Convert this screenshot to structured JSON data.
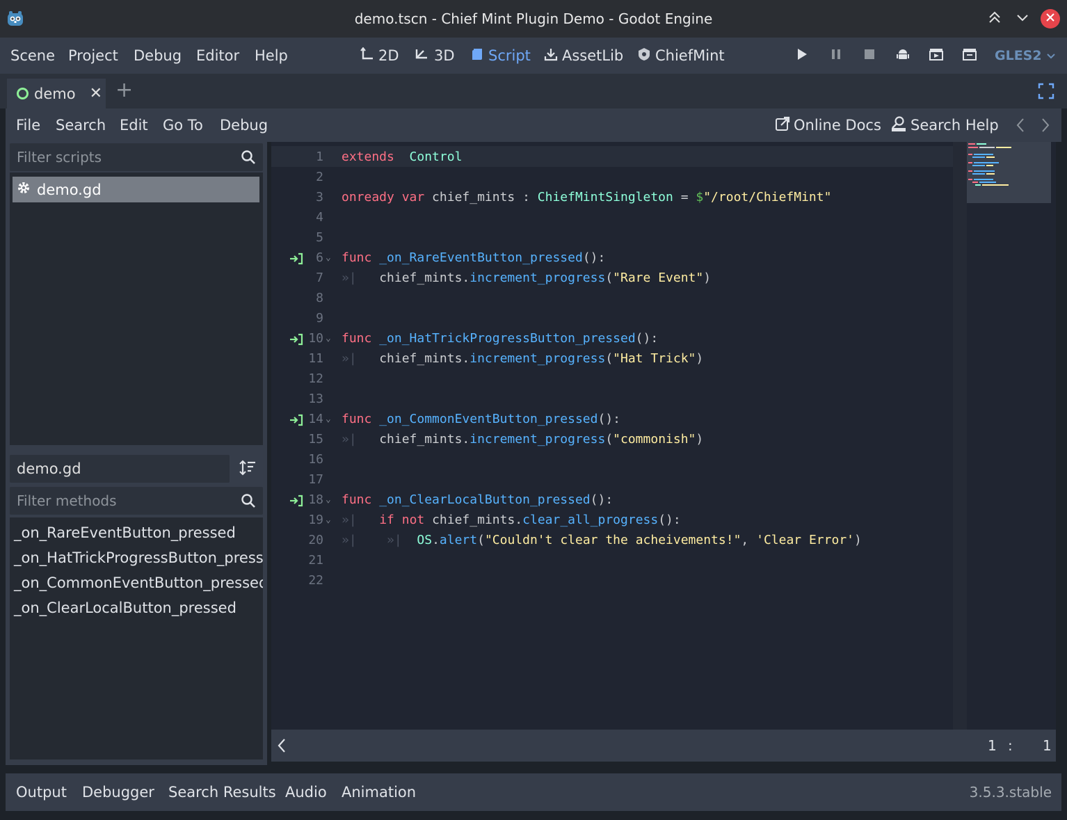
{
  "window": {
    "title": "demo.tscn - Chief Mint Plugin Demo - Godot Engine",
    "icons": [
      "godot-logo",
      "collapse-up",
      "chevron-down",
      "close"
    ],
    "close_color": "#e5444b"
  },
  "main_menu": {
    "items": [
      "Scene",
      "Project",
      "Debug",
      "Editor",
      "Help"
    ],
    "workspaces": [
      {
        "label": "2D",
        "icon": "2d-icon",
        "active": false
      },
      {
        "label": "3D",
        "icon": "3d-icon",
        "active": false
      },
      {
        "label": "Script",
        "icon": "script-icon",
        "active": true
      },
      {
        "label": "AssetLib",
        "icon": "download-icon",
        "active": false
      },
      {
        "label": "ChiefMint",
        "icon": "chiefmint-icon",
        "active": false
      }
    ],
    "tools": [
      "play-icon",
      "pause-icon",
      "stop-icon",
      "android-icon",
      "play-scene-icon",
      "play-custom-scene-icon"
    ],
    "renderer": "GLES2",
    "accent_color": "#6fa8f8"
  },
  "scene_tabs": {
    "active": "demo",
    "close_glyph": "✕",
    "add_glyph": "+"
  },
  "script_menu": {
    "items": [
      "File",
      "Search",
      "Edit",
      "Go To",
      "Debug"
    ],
    "online_docs": "Online Docs",
    "search_help": "Search Help"
  },
  "scripts_panel": {
    "filter_placeholder": "Filter scripts",
    "scripts": [
      "demo.gd"
    ],
    "current_script": "demo.gd",
    "methods_filter_placeholder": "Filter methods",
    "methods": [
      "_on_RareEventButton_pressed",
      "_on_HatTrickProgressButton_presse",
      "_on_CommonEventButton_pressed",
      "_on_ClearLocalButton_pressed"
    ]
  },
  "code": {
    "lines": [
      {
        "n": "1",
        "fold": false,
        "signal": false,
        "tokens": [
          [
            "kw",
            "extends"
          ],
          [
            "",
            "  "
          ],
          [
            "ty",
            "Control"
          ]
        ]
      },
      {
        "n": "2",
        "fold": false,
        "signal": false,
        "tokens": []
      },
      {
        "n": "3",
        "fold": false,
        "signal": false,
        "tokens": [
          [
            "kw",
            "onready"
          ],
          [
            "",
            " "
          ],
          [
            "kw",
            "var"
          ],
          [
            "",
            " chief_mints : "
          ],
          [
            "ty",
            "ChiefMintSingleton"
          ],
          [
            "",
            " = "
          ],
          [
            "np",
            "$"
          ],
          [
            "st",
            "\"/root/ChiefMint\""
          ]
        ]
      },
      {
        "n": "4",
        "fold": false,
        "signal": false,
        "tokens": []
      },
      {
        "n": "5",
        "fold": false,
        "signal": false,
        "tokens": []
      },
      {
        "n": "6",
        "fold": true,
        "signal": true,
        "tokens": [
          [
            "kw",
            "func"
          ],
          [
            "",
            " "
          ],
          [
            "fn",
            "_on_RareEventButton_pressed"
          ],
          [
            "",
            "():"
          ]
        ]
      },
      {
        "n": "7",
        "fold": false,
        "signal": false,
        "tokens": [
          [
            "tab",
            "»|  "
          ],
          [
            "",
            " chief_mints."
          ],
          [
            "fn",
            "increment_progress"
          ],
          [
            "",
            "("
          ],
          [
            "st",
            "\"Rare Event\""
          ],
          [
            "",
            ")"
          ]
        ]
      },
      {
        "n": "8",
        "fold": false,
        "signal": false,
        "tokens": []
      },
      {
        "n": "9",
        "fold": false,
        "signal": false,
        "tokens": []
      },
      {
        "n": "10",
        "fold": true,
        "signal": true,
        "tokens": [
          [
            "kw",
            "func"
          ],
          [
            "",
            " "
          ],
          [
            "fn",
            "_on_HatTrickProgressButton_pressed"
          ],
          [
            "",
            "():"
          ]
        ]
      },
      {
        "n": "11",
        "fold": false,
        "signal": false,
        "tokens": [
          [
            "tab",
            "»|  "
          ],
          [
            "",
            " chief_mints."
          ],
          [
            "fn",
            "increment_progress"
          ],
          [
            "",
            "("
          ],
          [
            "st",
            "\"Hat Trick\""
          ],
          [
            "",
            ")"
          ]
        ]
      },
      {
        "n": "12",
        "fold": false,
        "signal": false,
        "tokens": []
      },
      {
        "n": "13",
        "fold": false,
        "signal": false,
        "tokens": []
      },
      {
        "n": "14",
        "fold": true,
        "signal": true,
        "tokens": [
          [
            "kw",
            "func"
          ],
          [
            "",
            " "
          ],
          [
            "fn",
            "_on_CommonEventButton_pressed"
          ],
          [
            "",
            "():"
          ]
        ]
      },
      {
        "n": "15",
        "fold": false,
        "signal": false,
        "tokens": [
          [
            "tab",
            "»|  "
          ],
          [
            "",
            " chief_mints."
          ],
          [
            "fn",
            "increment_progress"
          ],
          [
            "",
            "("
          ],
          [
            "st",
            "\"commonish\""
          ],
          [
            "",
            ")"
          ]
        ]
      },
      {
        "n": "16",
        "fold": false,
        "signal": false,
        "tokens": []
      },
      {
        "n": "17",
        "fold": false,
        "signal": false,
        "tokens": []
      },
      {
        "n": "18",
        "fold": true,
        "signal": true,
        "tokens": [
          [
            "kw",
            "func"
          ],
          [
            "",
            " "
          ],
          [
            "fn",
            "_on_ClearLocalButton_pressed"
          ],
          [
            "",
            "():"
          ]
        ]
      },
      {
        "n": "19",
        "fold": true,
        "signal": false,
        "tokens": [
          [
            "tab",
            "»|  "
          ],
          [
            "",
            " "
          ],
          [
            "kw",
            "if"
          ],
          [
            "",
            " "
          ],
          [
            "kw",
            "not"
          ],
          [
            "",
            " chief_mints."
          ],
          [
            "fn",
            "clear_all_progress"
          ],
          [
            "",
            "():"
          ]
        ]
      },
      {
        "n": "20",
        "fold": false,
        "signal": false,
        "tokens": [
          [
            "tab",
            "»|  "
          ],
          [
            "tab",
            "  »|  "
          ],
          [
            "ty",
            "OS"
          ],
          [
            "",
            "."
          ],
          [
            "fn",
            "alert"
          ],
          [
            "",
            "("
          ],
          [
            "st",
            "\"Couldn't clear the acheivements!\""
          ],
          [
            "",
            ", "
          ],
          [
            "st",
            "'Clear Error'"
          ],
          [
            "",
            ")"
          ]
        ]
      },
      {
        "n": "21",
        "fold": false,
        "signal": false,
        "tokens": []
      },
      {
        "n": "22",
        "fold": false,
        "signal": false,
        "tokens": []
      }
    ],
    "syntax_colors": {
      "keyword": "#ff7085",
      "type": "#8effda",
      "function": "#57b3ff",
      "string": "#ffeda1",
      "signal": "#8eef97"
    }
  },
  "status": {
    "line": "1",
    "separator": ":",
    "column": "1"
  },
  "bottom_panel": {
    "tabs": [
      "Output",
      "Debugger",
      "Search Results",
      "Audio",
      "Animation"
    ],
    "version": "3.5.3.stable"
  }
}
